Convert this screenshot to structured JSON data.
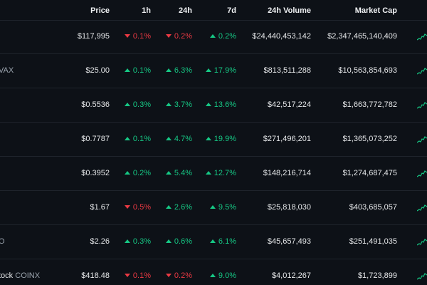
{
  "columns": {
    "price": "Price",
    "h1": "1h",
    "h24": "24h",
    "d7": "7d",
    "volume": "24h Volume",
    "mcap": "Market Cap"
  },
  "rows": [
    {
      "name": "",
      "ticker": "",
      "price": "$117,995",
      "h1": {
        "v": "0.1%",
        "dir": "down"
      },
      "h24": {
        "v": "0.2%",
        "dir": "down"
      },
      "d7": {
        "v": "0.2%",
        "dir": "up"
      },
      "volume": "$24,440,453,142",
      "mcap": "$2,347,465,140,409",
      "spark": "up"
    },
    {
      "name": "",
      "ticker": "VAX",
      "price": "$25.00",
      "h1": {
        "v": "0.1%",
        "dir": "up"
      },
      "h24": {
        "v": "6.3%",
        "dir": "up"
      },
      "d7": {
        "v": "17.9%",
        "dir": "up"
      },
      "volume": "$813,511,288",
      "mcap": "$10,563,854,693",
      "spark": "up"
    },
    {
      "name": "",
      "ticker": "",
      "price": "$0.5536",
      "h1": {
        "v": "0.3%",
        "dir": "up"
      },
      "h24": {
        "v": "3.7%",
        "dir": "up"
      },
      "d7": {
        "v": "13.6%",
        "dir": "up"
      },
      "volume": "$42,517,224",
      "mcap": "$1,663,772,782",
      "spark": "up"
    },
    {
      "name": "",
      "ticker": "",
      "price": "$0.7787",
      "h1": {
        "v": "0.1%",
        "dir": "up"
      },
      "h24": {
        "v": "4.7%",
        "dir": "up"
      },
      "d7": {
        "v": "19.9%",
        "dir": "up"
      },
      "volume": "$271,496,201",
      "mcap": "$1,365,073,252",
      "spark": "up"
    },
    {
      "name": "",
      "ticker": "",
      "price": "$0.3952",
      "h1": {
        "v": "0.2%",
        "dir": "up"
      },
      "h24": {
        "v": "5.4%",
        "dir": "up"
      },
      "d7": {
        "v": "12.7%",
        "dir": "up"
      },
      "volume": "$148,216,714",
      "mcap": "$1,274,687,475",
      "spark": "up"
    },
    {
      "name": "",
      "ticker": "",
      "price": "$1.67",
      "h1": {
        "v": "0.5%",
        "dir": "down"
      },
      "h24": {
        "v": "2.6%",
        "dir": "up"
      },
      "d7": {
        "v": "9.5%",
        "dir": "up"
      },
      "volume": "$25,818,030",
      "mcap": "$403,685,057",
      "spark": "up"
    },
    {
      "name": "",
      "ticker": "O",
      "price": "$2.26",
      "h1": {
        "v": "0.3%",
        "dir": "up"
      },
      "h24": {
        "v": "0.6%",
        "dir": "up"
      },
      "d7": {
        "v": "6.1%",
        "dir": "up"
      },
      "volume": "$45,657,493",
      "mcap": "$251,491,035",
      "spark": "up"
    },
    {
      "name": "tock",
      "ticker": "COINX",
      "price": "$418.48",
      "h1": {
        "v": "0.1%",
        "dir": "down"
      },
      "h24": {
        "v": "0.2%",
        "dir": "down"
      },
      "d7": {
        "v": "9.0%",
        "dir": "up"
      },
      "volume": "$4,012,267",
      "mcap": "$1,723,899",
      "spark": "up"
    }
  ],
  "colors": {
    "background": "#0d1117",
    "up": "#16c784",
    "down": "#ea3943",
    "divider": "#1f242c"
  }
}
